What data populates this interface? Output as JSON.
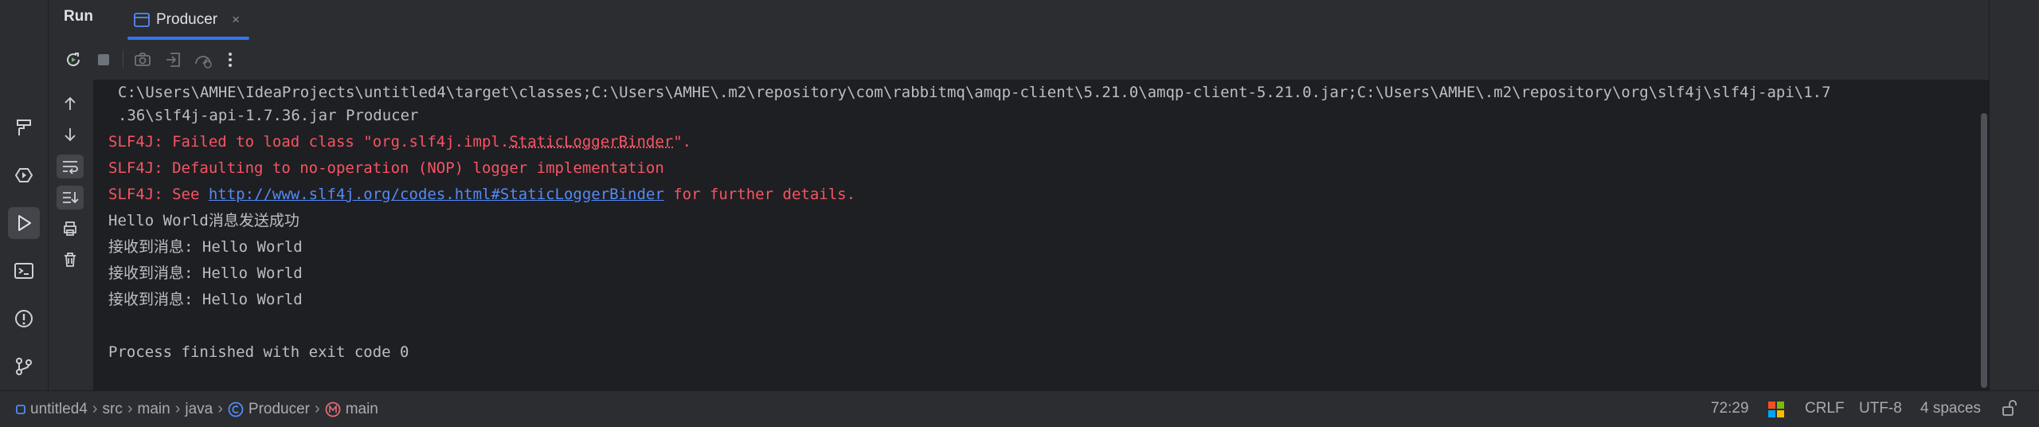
{
  "tool_window": {
    "title": "Run",
    "tab": {
      "label": "Producer",
      "close": "×"
    }
  },
  "console": {
    "lines": [
      {
        "text": "C:\\Users\\AMHE\\IdeaProjects\\untitled4\\target\\classes;C:\\Users\\AMHE\\.m2\\repository\\com\\rabbitmq\\amqp-client\\5.21.0\\amqp-client-5.21.0.jar;C:\\Users\\AMHE\\.m2\\repository\\org\\slf4j\\slf4j-api\\1.7"
      },
      {
        "text": ".36\\slf4j-api-1.7.36.jar Producer"
      },
      {
        "prefix": "SLF4J: Failed to load class \"org.slf4j.impl.",
        "underlined": "StaticLoggerBinder",
        "suffix": "\"."
      },
      {
        "text": "SLF4J: Defaulting to no-operation (NOP) logger implementation"
      },
      {
        "prefix": "SLF4J: See ",
        "link": "http://www.slf4j.org/codes.html#StaticLoggerBinder",
        "suffix": " for further details."
      },
      {
        "text": "Hello World消息发送成功"
      },
      {
        "text": "接收到消息: Hello World"
      },
      {
        "text": "接收到消息: Hello World"
      },
      {
        "text": "接收到消息: Hello World"
      },
      {
        "text": ""
      },
      {
        "text": "Process finished with exit code 0"
      }
    ]
  },
  "status_bar": {
    "breadcrumb": [
      "untitled4",
      "src",
      "main",
      "java",
      "Producer",
      "main"
    ],
    "separator": "›",
    "position": "72:29",
    "line_ending": "CRLF",
    "encoding": "UTF-8",
    "indent": "4 spaces"
  },
  "colors": {
    "background": "#1e1f22",
    "panel": "#2b2d30",
    "error_text": "#f75464",
    "link": "#548af7",
    "accent": "#3574f0"
  },
  "icons": {
    "left_bar": [
      "paint-roller-icon",
      "services-icon",
      "run-icon",
      "terminal-icon",
      "problems-icon",
      "git-icon"
    ],
    "toolbar": [
      "rerun-icon",
      "stop-icon",
      "camera-icon",
      "exit-icon",
      "profiler-icon",
      "more-icon"
    ],
    "console_side": [
      "arrow-up-icon",
      "arrow-down-icon",
      "soft-wrap-icon",
      "scroll-to-end-icon",
      "print-icon",
      "trash-icon"
    ]
  }
}
